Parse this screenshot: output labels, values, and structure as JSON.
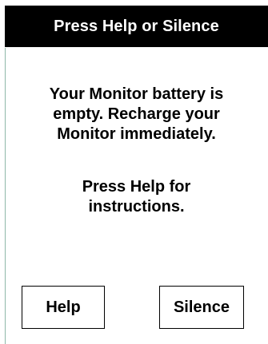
{
  "header": {
    "title": "Press Help or Silence"
  },
  "alert": {
    "message_lines": [
      "Your Monitor battery is",
      "empty. Recharge your",
      "Monitor immediately."
    ],
    "instruction_lines": [
      "Press Help for",
      "instructions."
    ]
  },
  "buttons": {
    "help_label": "Help",
    "silence_label": "Silence"
  },
  "colors": {
    "title_bar_bg": "#000000",
    "title_text": "#ffffff",
    "body_bg": "#ffffff",
    "frame_accent": "#8fb8a8"
  }
}
